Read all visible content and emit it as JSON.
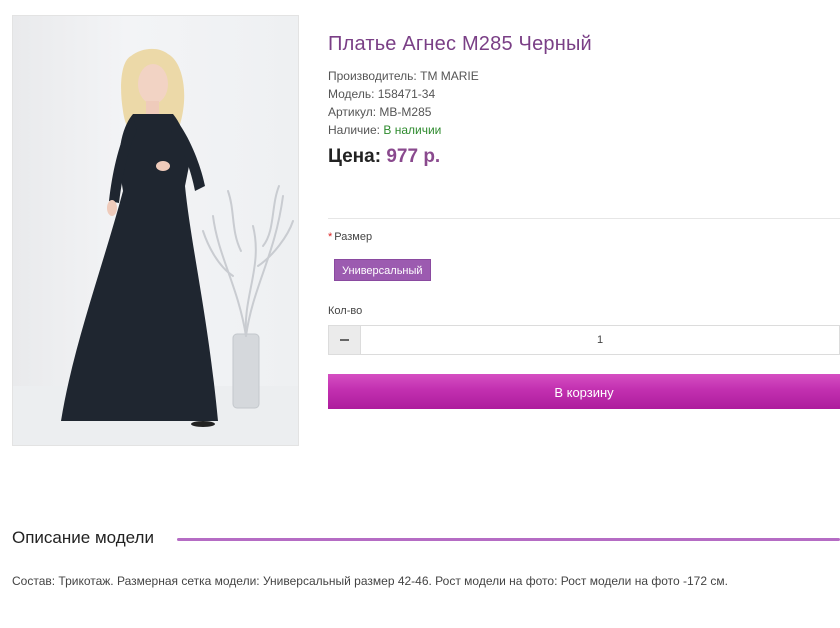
{
  "product": {
    "title": "Платье Агнес М285 Черный",
    "manufacturer_label": "Производитель:",
    "manufacturer_value": "ТМ MARIE",
    "model_label": "Модель:",
    "model_value": "158471-34",
    "sku_label": "Артикул:",
    "sku_value": "MB-M285",
    "availability_label": "Наличие:",
    "availability_value": "В наличии",
    "price_label": "Цена:",
    "price_value": "977 р."
  },
  "options": {
    "size_required_mark": "*",
    "size_label": "Размер",
    "size_selected": "Универсальный",
    "qty_label": "Кол-во",
    "qty_value": "1"
  },
  "cart": {
    "button_label": "В корзину"
  },
  "description": {
    "heading": "Описание модели",
    "text": "Состав: Трикотаж. Размерная сетка модели: Универсальный размер 42-46. Рост модели на фото: Рост модели на фото -172 см."
  },
  "colors": {
    "title": "#7a3f86",
    "accent": "#c230b0",
    "size_chip": "#9c5bb0",
    "in_stock": "#2e8b2e"
  }
}
